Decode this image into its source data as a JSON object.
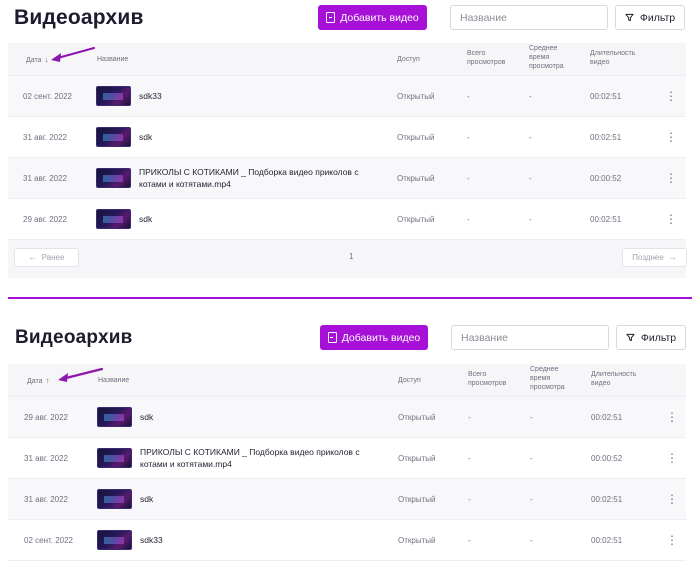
{
  "colors": {
    "accent": "#a710d6",
    "arrow": "#8e16b0",
    "divider": "#a710d6"
  },
  "panels": [
    {
      "title": "Видеоархив",
      "add_label": "Добавить видео",
      "search_placeholder": "Название",
      "filter_label": "Фильтр",
      "columns": {
        "date": "Дата",
        "date_sort_icon": "↓",
        "name": "Название",
        "access": "Доступ",
        "views": "Всего\nпросмотров",
        "avg": "Среднее\nвремя\nпросмотра",
        "duration": "Длительность\nвидео"
      },
      "rows": [
        {
          "date": "02 сент. 2022",
          "name": "sdk33",
          "access": "Открытый",
          "views": "-",
          "avg": "-",
          "duration": "00:02:51"
        },
        {
          "date": "31 авг. 2022",
          "name": "sdk",
          "access": "Открытый",
          "views": "-",
          "avg": "-",
          "duration": "00:02:51"
        },
        {
          "date": "31 авг. 2022",
          "name": "ПРИКОЛЫ С КОТИКАМИ _ Подборка видео приколов с котами и котятами.mp4",
          "access": "Открытый",
          "views": "-",
          "avg": "-",
          "duration": "00:00:52"
        },
        {
          "date": "29 авг. 2022",
          "name": "sdk",
          "access": "Открытый",
          "views": "-",
          "avg": "-",
          "duration": "00:02:51"
        }
      ],
      "pager": {
        "prev": "Ранее",
        "page": "1",
        "next": "Позднее"
      }
    },
    {
      "title": "Видеоархив",
      "add_label": "Добавить видео",
      "search_placeholder": "Название",
      "filter_label": "Фильтр",
      "columns": {
        "date": "Дата",
        "date_sort_icon": "↑",
        "name": "Название",
        "access": "Доступ",
        "views": "Всего\nпросмотров",
        "avg": "Среднее\nвремя\nпросмотра",
        "duration": "Длительность\nвидео"
      },
      "rows": [
        {
          "date": "29 авг. 2022",
          "name": "sdk",
          "access": "Открытый",
          "views": "-",
          "avg": "-",
          "duration": "00:02:51"
        },
        {
          "date": "31 авг. 2022",
          "name": "ПРИКОЛЫ С КОТИКАМИ _ Подборка видео приколов с котами и котятами.mp4",
          "access": "Открытый",
          "views": "-",
          "avg": "-",
          "duration": "00:00:52"
        },
        {
          "date": "31 авг. 2022",
          "name": "sdk",
          "access": "Открытый",
          "views": "-",
          "avg": "-",
          "duration": "00:02:51"
        },
        {
          "date": "02 сент. 2022",
          "name": "sdk33",
          "access": "Открытый",
          "views": "-",
          "avg": "-",
          "duration": "00:02:51"
        }
      ]
    }
  ]
}
